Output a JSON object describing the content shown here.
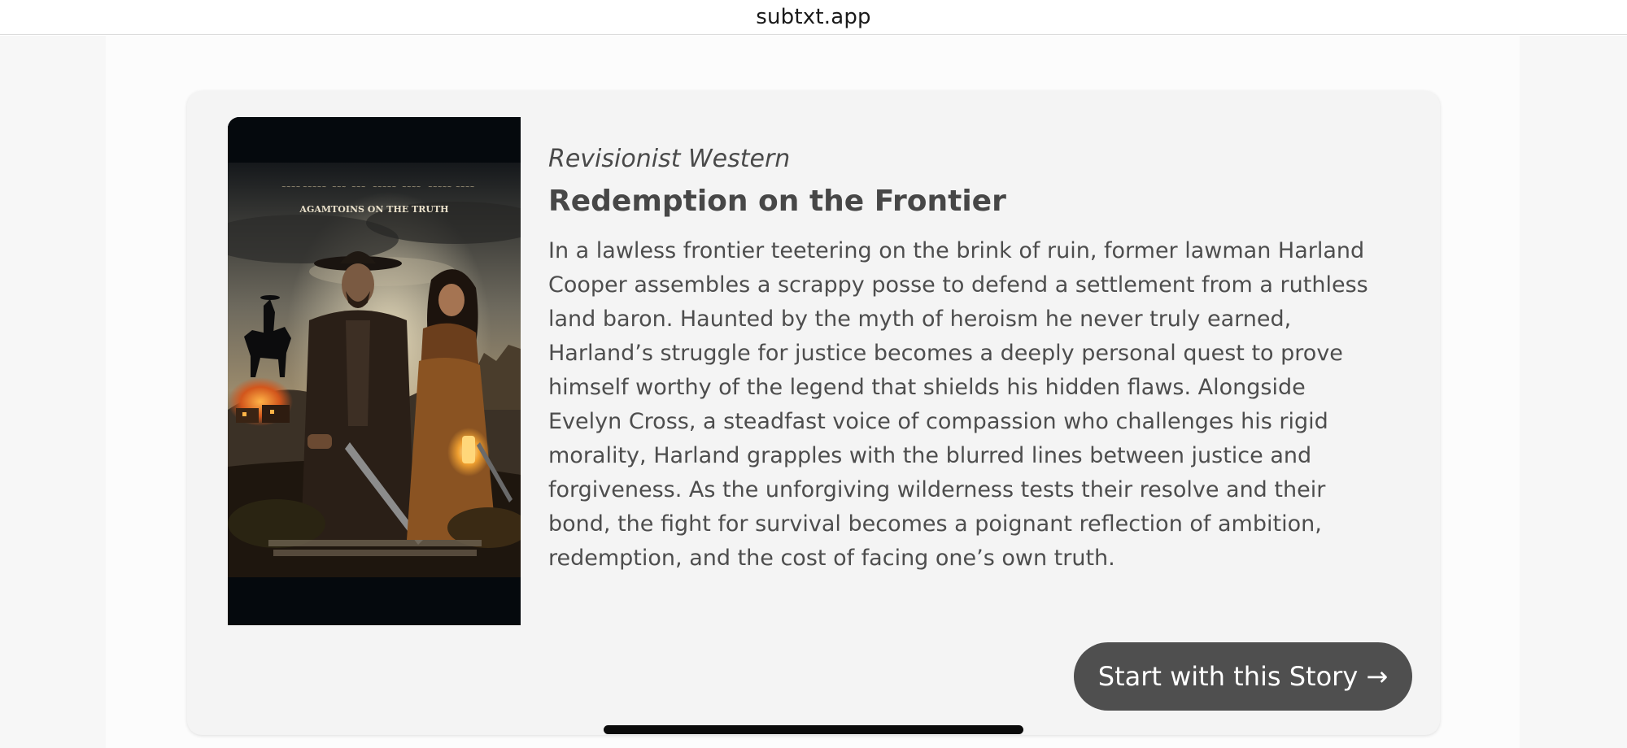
{
  "browser": {
    "url": "subtxt.app"
  },
  "story": {
    "genre": "Revisionist Western",
    "title": "Redemption on the Frontier",
    "synopsis": "In a lawless frontier teetering on the brink of ruin, former lawman Harland Cooper assembles a scrappy posse to defend a settlement from a ruthless land baron. Haunted by the myth of heroism he never truly earned, Harland’s struggle for justice becomes a deeply personal quest to prove himself worthy of the legend that shields his hidden flaws. Alongside Evelyn Cross, a steadfast voice of compassion who challenges his rigid morality, Harland grapples with the blurred lines between justice and forgiveness. As the unforgiving wilderness tests their resolve and their bond, the fight for survival becomes a poignant reflection of ambition, redemption, and the cost of facing one’s own truth.",
    "poster": {
      "tagline": "AGAMTOINS ON THE TRUTH"
    },
    "cta_label": "Start with this Story →"
  }
}
